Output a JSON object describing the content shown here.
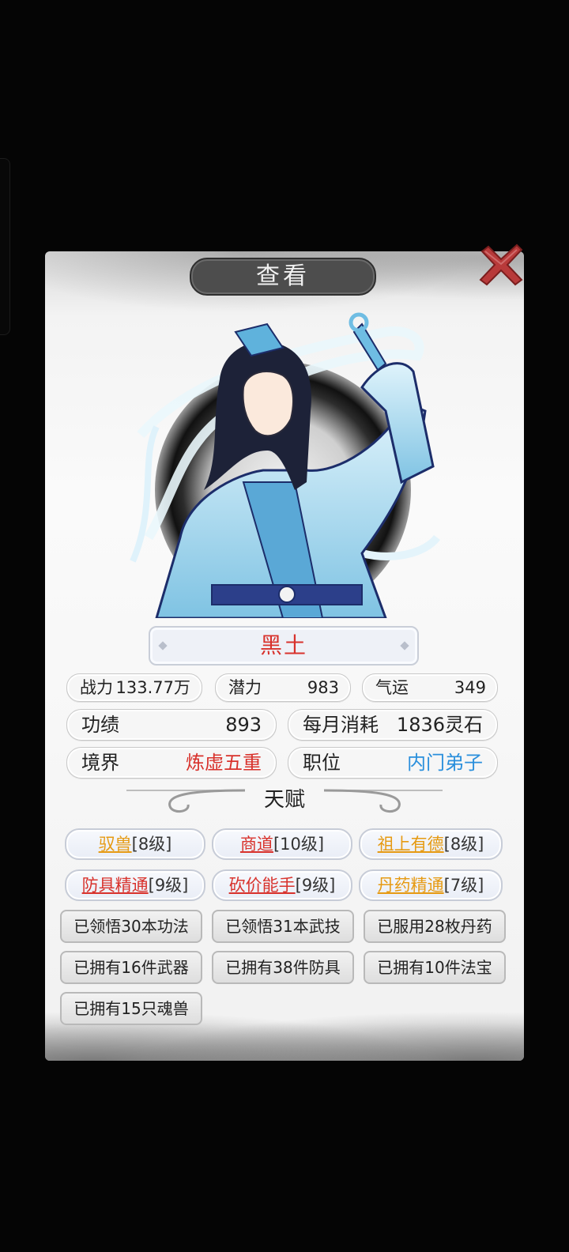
{
  "dialog": {
    "title": "查看",
    "close_icon": "close-x-icon"
  },
  "character": {
    "name": "黑土",
    "portrait_icon": "character-portrait"
  },
  "stats_row1": [
    {
      "label": "战力",
      "value": "133.77万"
    },
    {
      "label": "潜力",
      "value": "983"
    },
    {
      "label": "气运",
      "value": "349"
    }
  ],
  "stats_row2": [
    {
      "label": "功绩",
      "value": "893"
    },
    {
      "label": "每月消耗",
      "value": "1836灵石"
    }
  ],
  "stats_row3": [
    {
      "label": "境界",
      "value": "炼虚五重",
      "value_color": "#d8322c"
    },
    {
      "label": "职位",
      "value": "内门弟子",
      "value_color": "#2a8fdc"
    }
  ],
  "talent_section": {
    "title": "天赋"
  },
  "talents": [
    {
      "name": "驭兽",
      "level": "[8级]",
      "color": "gold"
    },
    {
      "name": "商道",
      "level": "[10级]",
      "color": "red"
    },
    {
      "name": "祖上有德",
      "level": "[8级]",
      "color": "gold"
    },
    {
      "name": "防具精通",
      "level": "[9级]",
      "color": "red"
    },
    {
      "name": "砍价能手",
      "level": "[9级]",
      "color": "red"
    },
    {
      "name": "丹药精通",
      "level": "[7级]",
      "color": "gold"
    }
  ],
  "achievements": [
    "已领悟30本功法",
    "已领悟31本武技",
    "已服用28枚丹药",
    "已拥有16件武器",
    "已拥有38件防具",
    "已拥有10件法宝",
    "已拥有15只魂兽"
  ]
}
